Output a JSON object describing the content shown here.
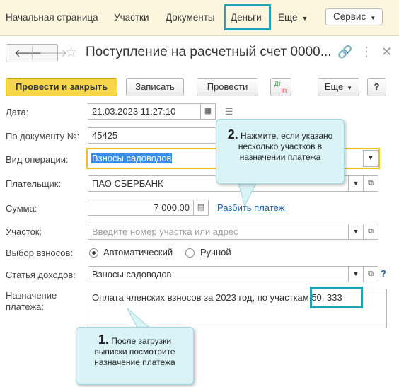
{
  "topnav": {
    "items": [
      "Начальная страница",
      "Участки",
      "Документы",
      "Деньги"
    ],
    "more_label": "Еще",
    "service_label": "Сервис"
  },
  "window": {
    "title": "Поступление на расчетный счет 0000..."
  },
  "toolbar": {
    "post_close_label": "Провести и закрыть",
    "save_label": "Записать",
    "post_label": "Провести",
    "dtkt_top": "Дт",
    "dtkt_bottom": "Кт",
    "more_label": "Еще",
    "help_label": "?"
  },
  "form": {
    "date": {
      "label": "Дата:",
      "value": "21.03.2023 11:27:10"
    },
    "doc_number": {
      "label": "По документу №:",
      "value": "45425"
    },
    "operation_type": {
      "label": "Вид операции:",
      "value": "Взносы садоводов"
    },
    "payer": {
      "label": "Плательщик:",
      "value": "ПАО СБЕРБАНК"
    },
    "amount": {
      "label": "Сумма:",
      "value": "7 000,00",
      "split_link": "Разбить платеж"
    },
    "plot": {
      "label": "Участок:",
      "placeholder": "Введите номер участка или адрес"
    },
    "contribution_choice": {
      "label": "Выбор взносов:",
      "options": [
        "Автоматический",
        "Ручной"
      ],
      "selected": "Автоматический"
    },
    "income_item": {
      "label": "Статья доходов:",
      "value": "Взносы садоводов",
      "help": "?"
    },
    "purpose": {
      "label_line1": "Назначение",
      "label_line2": "платежа:",
      "value": "Оплата членских взносов за 2023 год, по участкам 50, 333"
    }
  },
  "callouts": {
    "one": {
      "number": "1.",
      "line1": "После загрузки",
      "line2": "выписки посмотрите",
      "line3": "назначение платежа"
    },
    "two": {
      "number": "2.",
      "line1": "Нажмите, если указано",
      "line2": "несколько участков в",
      "line3": "назначении платежа"
    }
  },
  "colors": {
    "highlight": "#1fa3b4",
    "primary_button": "#f6d64b",
    "callout_bg": "#d9f3f7",
    "link": "#1d5fa8",
    "selection": "#3b8ee8"
  }
}
